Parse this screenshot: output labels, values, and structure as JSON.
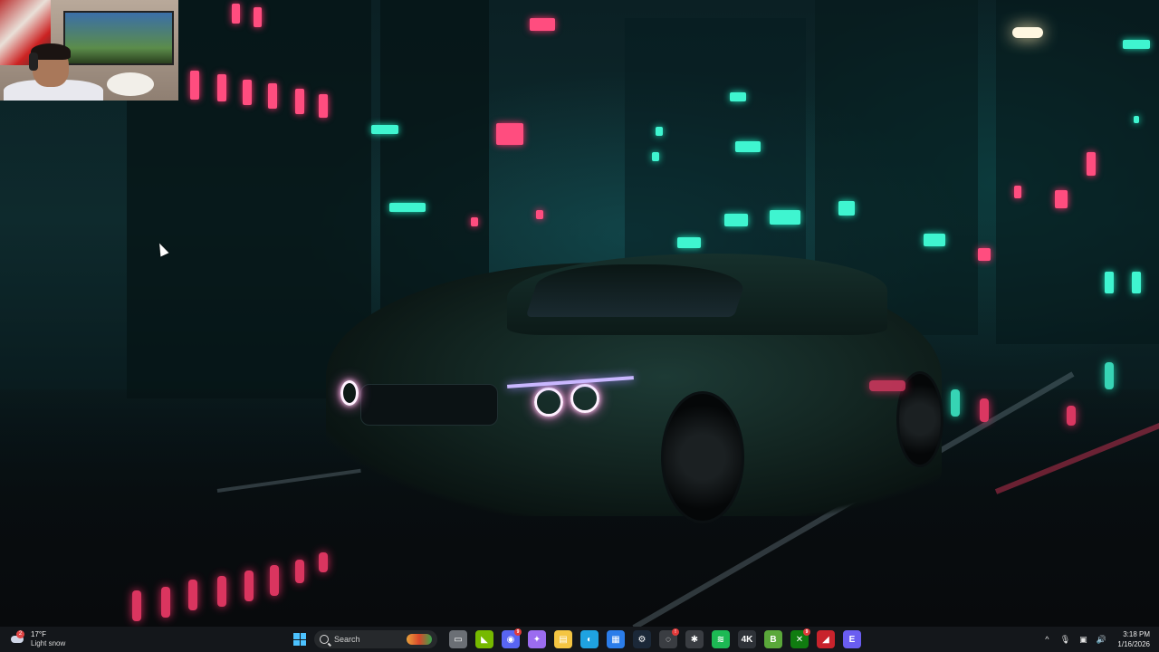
{
  "weather": {
    "temperature": "17°F",
    "condition": "Light snow",
    "alert_count": "2"
  },
  "taskbar": {
    "search_label": "Search",
    "icons": [
      {
        "name": "file-explorer-dim-icon",
        "glyph": "▭",
        "color": "#6b6f75"
      },
      {
        "name": "nvidia-icon",
        "glyph": "◣",
        "color": "#76b900"
      },
      {
        "name": "discord-icon",
        "glyph": "◉",
        "color": "#5865f2",
        "badge": "9"
      },
      {
        "name": "copilot-icon",
        "glyph": "✦",
        "color": "#9b6cf0"
      },
      {
        "name": "file-explorer-icon",
        "glyph": "▤",
        "color": "#f4c542"
      },
      {
        "name": "edge-icon",
        "glyph": "◐",
        "color": "#1fa3e0"
      },
      {
        "name": "microsoft-store-icon",
        "glyph": "▦",
        "color": "#2b7de9"
      },
      {
        "name": "steam-icon",
        "glyph": "⚙",
        "color": "#1b2838"
      },
      {
        "name": "record-icon",
        "glyph": "◌",
        "color": "#3a3d42",
        "badge": "!"
      },
      {
        "name": "settings-icon",
        "glyph": "✱",
        "color": "#3a3d42"
      },
      {
        "name": "spotify-icon",
        "glyph": "≋",
        "color": "#1db954"
      },
      {
        "name": "4k-app-icon",
        "glyph": "4K",
        "color": "#2e3238"
      },
      {
        "name": "b-app-icon",
        "glyph": "B",
        "color": "#5aa83a"
      },
      {
        "name": "xbox-icon",
        "glyph": "✕",
        "color": "#107c10",
        "badge": "9"
      },
      {
        "name": "red-app-icon",
        "glyph": "◢",
        "color": "#c8232c"
      },
      {
        "name": "e-app-icon",
        "glyph": "E",
        "color": "#6a5df0"
      }
    ]
  },
  "tray": {
    "chevron": "^",
    "mic": "🎙",
    "network": "▣",
    "volume": "🔊"
  },
  "clock": {
    "time": "3:18 PM",
    "date": "1/16/2026"
  }
}
